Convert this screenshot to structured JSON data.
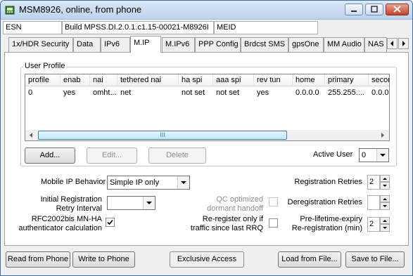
{
  "window": {
    "title": "MSM8926, online, from phone"
  },
  "infobar": {
    "esn_label": "ESN",
    "build": "Build MPSS.DI.2.0.1.c1.15-00021-M8926I",
    "meid_label": "MEID"
  },
  "tabs": [
    {
      "label": "1x/HDR Security"
    },
    {
      "label": "Data"
    },
    {
      "label": "IPv6"
    },
    {
      "label": "M.IP"
    },
    {
      "label": "M.IPv6"
    },
    {
      "label": "PPP Config"
    },
    {
      "label": "Brdcst SMS"
    },
    {
      "label": "gpsOne"
    },
    {
      "label": "MM Audio"
    },
    {
      "label": "NAS"
    }
  ],
  "user_profile": {
    "group_label": "User Profile",
    "columns": [
      "profile",
      "enab",
      "nai",
      "tethered nai",
      "ha spi",
      "aaa spi",
      "rev tun",
      "home",
      "primary",
      "secon"
    ],
    "rows": [
      [
        "0",
        "yes",
        "omht...",
        "net",
        "not set",
        "not set",
        "yes",
        "0.0.0.0",
        "255.255....",
        "0.0.0."
      ]
    ],
    "scroll_thumb_label": "III",
    "add_label": "Add...",
    "edit_label": "Edit...",
    "delete_label": "Delete",
    "active_user_label": "Active User",
    "active_user_value": "0"
  },
  "settings": {
    "mip_behavior_label": "Mobile IP Behavior",
    "mip_behavior_value": "Simple IP only",
    "init_reg_label_1": "Initial Registration",
    "init_reg_label_2": "Retry Interval",
    "init_reg_value": "",
    "rfc_label_1": "RFC2002bis MN-HA",
    "rfc_label_2": "authenticator calculation",
    "rfc_checked": true,
    "qc_label_1": "QC optimized",
    "qc_label_2": "dormant handoff",
    "rereg_label_1": "Re-register only if",
    "rereg_label_2": "traffic since last RRQ",
    "reg_retries_label": "Registration Retries",
    "reg_retries_value": "2",
    "dereg_retries_label": "Deregistration Retries",
    "dereg_retries_value": "",
    "prelife_label_1": "Pre-lifetime-expiry",
    "prelife_label_2": "Re-registration (min)",
    "prelife_value": "2"
  },
  "footer": {
    "read_label": "Read from Phone",
    "write_label": "Write to Phone",
    "exclusive_label": "Exclusive Access",
    "load_label": "Load from File...",
    "save_label": "Save to File..."
  }
}
